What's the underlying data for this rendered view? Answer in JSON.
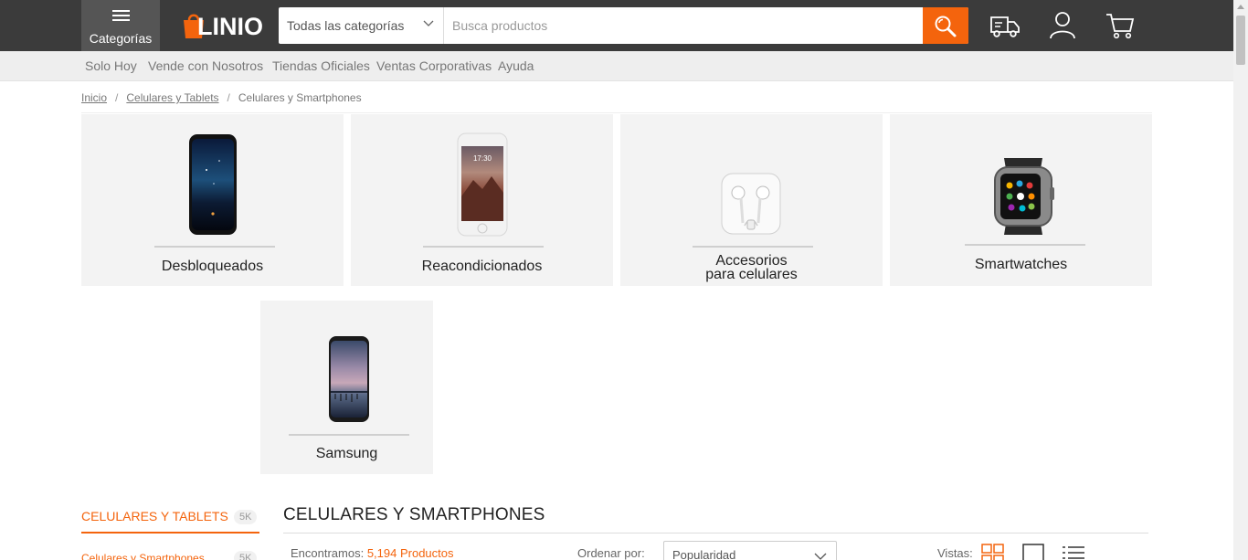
{
  "header": {
    "categories_label": "Categorías",
    "logo_text": "LINIO",
    "search": {
      "category_value": "Todas las categorías",
      "placeholder": "Busca productos"
    },
    "icons": [
      "shipping-truck-icon",
      "user-icon",
      "cart-icon"
    ]
  },
  "subnav": {
    "items": [
      "Solo Hoy",
      "Vende con Nosotros",
      "Tiendas Oficiales",
      "Ventas Corporativas",
      "Ayuda"
    ]
  },
  "breadcrumb": {
    "items": [
      "Inicio",
      "Celulares y Tablets",
      "Celulares y Smartphones"
    ],
    "separator": "/"
  },
  "categories": [
    {
      "label": "Desbloqueados"
    },
    {
      "label": "Reacondicionados"
    },
    {
      "label_line1": "Accesorios",
      "label_line2": "para celulares"
    },
    {
      "label": "Smartwatches"
    },
    {
      "label": "Samsung"
    }
  ],
  "sidebar": {
    "heading": "CELULARES Y TABLETS",
    "heading_count": "5K",
    "items": [
      {
        "label": "Celulares y Smartphones",
        "count": "5K"
      }
    ]
  },
  "results": {
    "title": "CELULARES Y SMARTPHONES",
    "found_prefix": "Encontramos:",
    "found_count": "5,194 Productos",
    "order_label": "Ordenar por:",
    "order_value": "Popularidad",
    "views_label": "Vistas:"
  },
  "colors": {
    "accent": "#f4640d",
    "topbar": "#3b3b3b",
    "tile_bg": "#f3f3f3"
  }
}
